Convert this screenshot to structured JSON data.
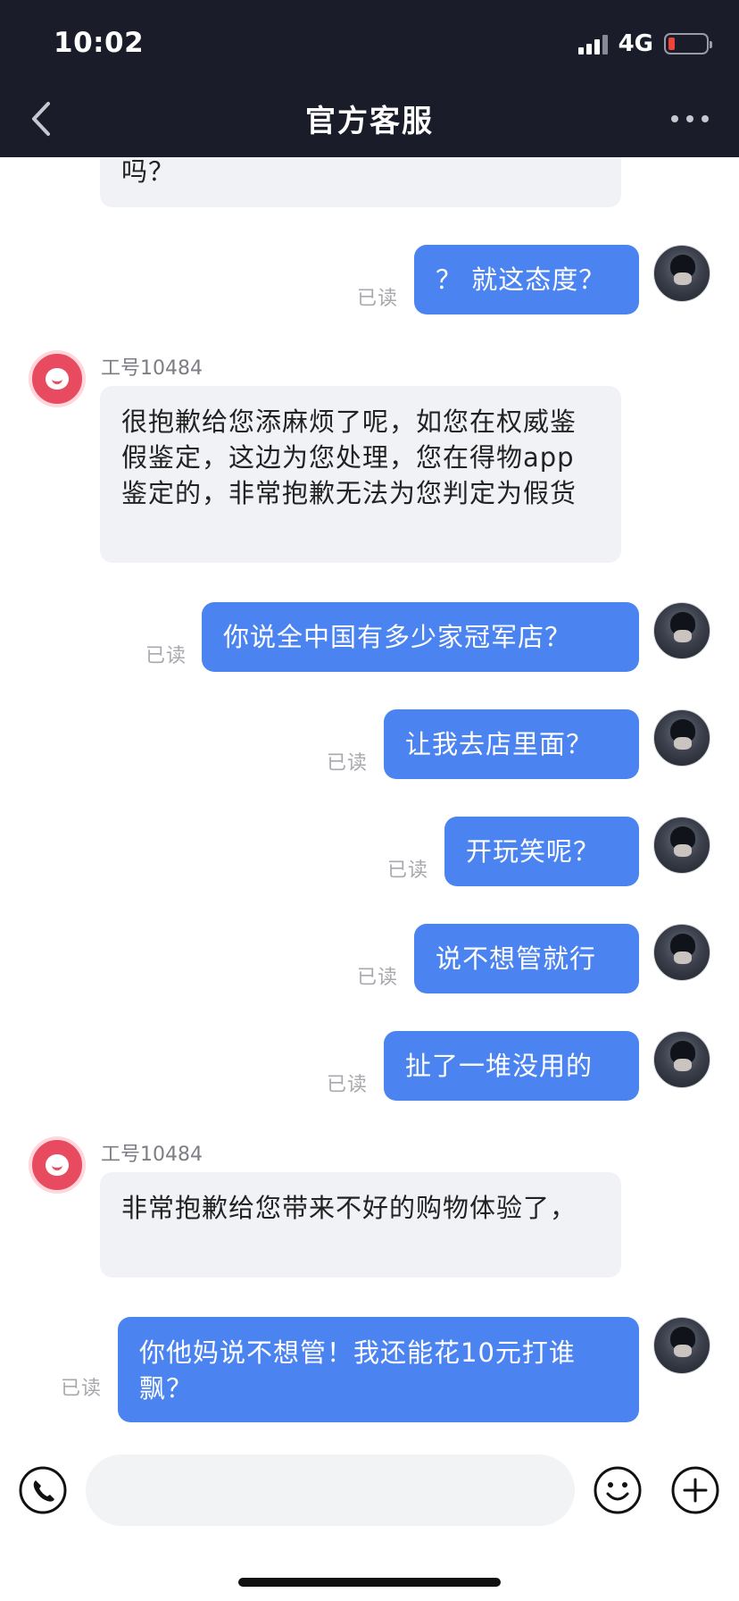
{
  "status_bar": {
    "time": "10:02",
    "network": "4G"
  },
  "nav": {
    "title": "官方客服",
    "back_icon": "chevron-left-icon",
    "more_icon": "more-dots-icon"
  },
  "read_label": "已读",
  "messages": [
    {
      "side": "in",
      "text": "吗？"
    },
    {
      "side": "out",
      "text": "？ 就这态度？"
    },
    {
      "side": "in",
      "sender": "工号10484",
      "text": "很抱歉给您添麻烦了呢，如您在权威鉴假鉴定，这边为您处理，您在得物app鉴定的，非常抱歉无法为您判定为假货"
    },
    {
      "side": "out",
      "text": "你说全中国有多少家冠军店？"
    },
    {
      "side": "out",
      "text": "让我去店里面？"
    },
    {
      "side": "out",
      "text": "开玩笑呢？"
    },
    {
      "side": "out",
      "text": "说不想管就行"
    },
    {
      "side": "out",
      "text": "扯了一堆没用的"
    },
    {
      "side": "in",
      "sender": "工号10484",
      "text": "非常抱歉给您带来不好的购物体验了，"
    },
    {
      "side": "out",
      "text": "你他妈说不想管！我还能花10元打谁飘？"
    }
  ],
  "composer": {
    "placeholder": "",
    "phone_icon": "phone-icon",
    "emoji_icon": "emoji-icon",
    "plus_icon": "plus-icon"
  },
  "colors": {
    "header_bg": "#1b1c2a",
    "outgoing_bubble": "#4b84f0",
    "incoming_bubble": "#f0f2f6"
  }
}
